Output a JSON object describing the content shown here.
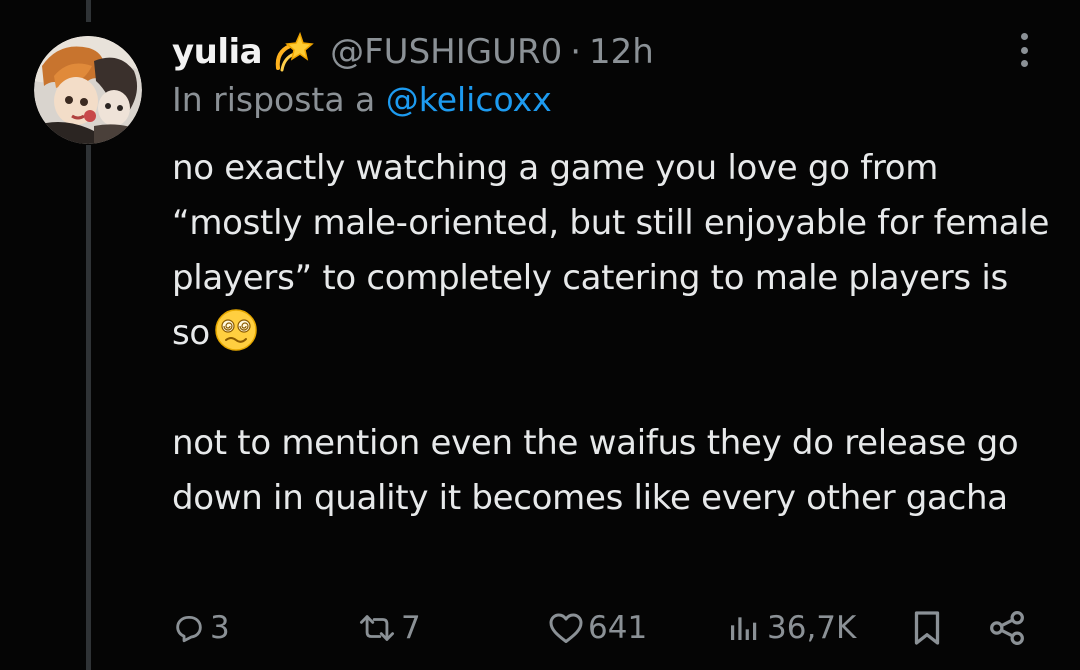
{
  "tweet": {
    "author": {
      "name": "yulia",
      "badge_icon": "dizzy-emoji",
      "handle": "@FUSHIGUR0",
      "avatar_icon": "anime-avatar"
    },
    "time_separator": "·",
    "time": "12h",
    "reply": {
      "prefix": "In risposta a",
      "mention": "@kelicoxx"
    },
    "paragraphs": [
      {
        "text": "no exactly watching a game you love go from “mostly male-oriented, but still enjoyable for female players” to completely catering to male players is so",
        "trailing_emoji": "woozy-face-emoji"
      },
      {
        "text": "not to mention even the waifus they do release go down in quality it becomes like every other gacha"
      }
    ],
    "actions": {
      "replies": "3",
      "retweets": "7",
      "likes": "641",
      "views": "36,7K"
    }
  },
  "colors": {
    "background": "#050505",
    "text": "#e7e9ea",
    "muted": "#8b9196",
    "link": "#1d9bf0"
  }
}
